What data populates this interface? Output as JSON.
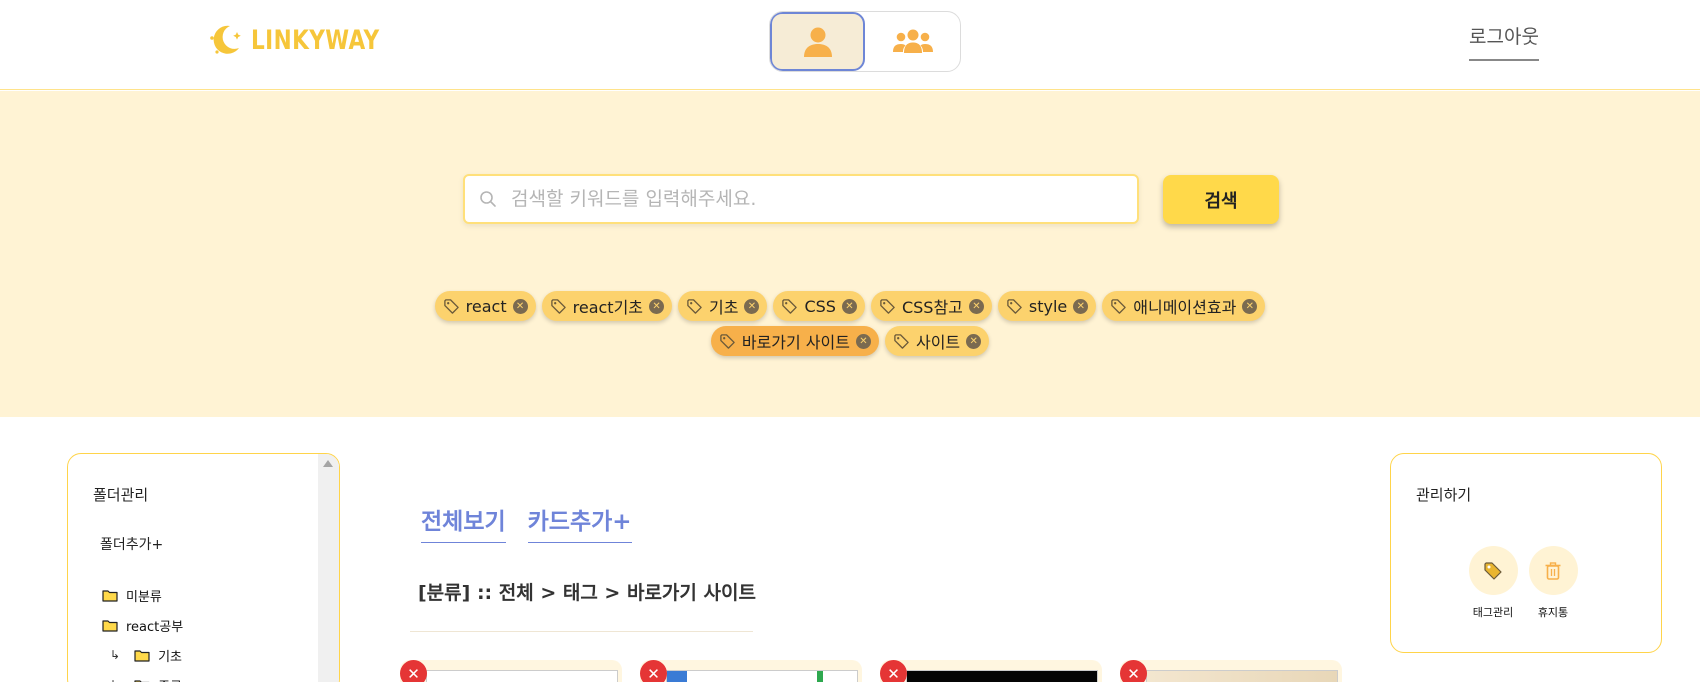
{
  "header": {
    "logo_text": "LINKYWAY",
    "logout_label": "로그아웃",
    "modes": [
      {
        "name": "personal",
        "icon": "user-icon",
        "active": true
      },
      {
        "name": "group",
        "icon": "users-icon",
        "active": false
      }
    ]
  },
  "search": {
    "placeholder": "검색할 키워드를 입력해주세요.",
    "value": "",
    "button_label": "검색"
  },
  "tags": [
    {
      "label": "react",
      "active": false
    },
    {
      "label": "react기초",
      "active": false
    },
    {
      "label": "기초",
      "active": false
    },
    {
      "label": "CSS",
      "active": false
    },
    {
      "label": "CSS참고",
      "active": false
    },
    {
      "label": "style",
      "active": false
    },
    {
      "label": "애니메이션효과",
      "active": false
    },
    {
      "label": "바로가기 사이트",
      "active": true
    },
    {
      "label": "사이트",
      "active": false
    }
  ],
  "folder_panel": {
    "title": "폴더관리",
    "add_label": "폴더추가+",
    "items": [
      {
        "label": "미분류",
        "sub": false
      },
      {
        "label": "react공부",
        "sub": false
      },
      {
        "label": "기초",
        "sub": true
      },
      {
        "label": "중급",
        "sub": true
      }
    ],
    "sub_arrow": "↳"
  },
  "main": {
    "tabs": [
      {
        "label": "전체보기"
      },
      {
        "label": "카드추가+"
      }
    ],
    "breadcrumb": "[분류] :: 전체 > 태그 > 바로가기 사이트",
    "card_delete_symbol": "✕",
    "card_count": 4
  },
  "manage_panel": {
    "title": "관리하기",
    "items": [
      {
        "label": "태그관리",
        "icon": "tag-icon"
      },
      {
        "label": "휴지통",
        "icon": "trash-icon"
      }
    ]
  },
  "colors": {
    "accent_yellow": "#ffd94a",
    "band_bg": "#fff3d4",
    "tag_bg": "#fcd26d",
    "tag_active_bg": "#f7b04a",
    "tab_blue": "#6f84d9",
    "delete_red": "#e53535"
  }
}
